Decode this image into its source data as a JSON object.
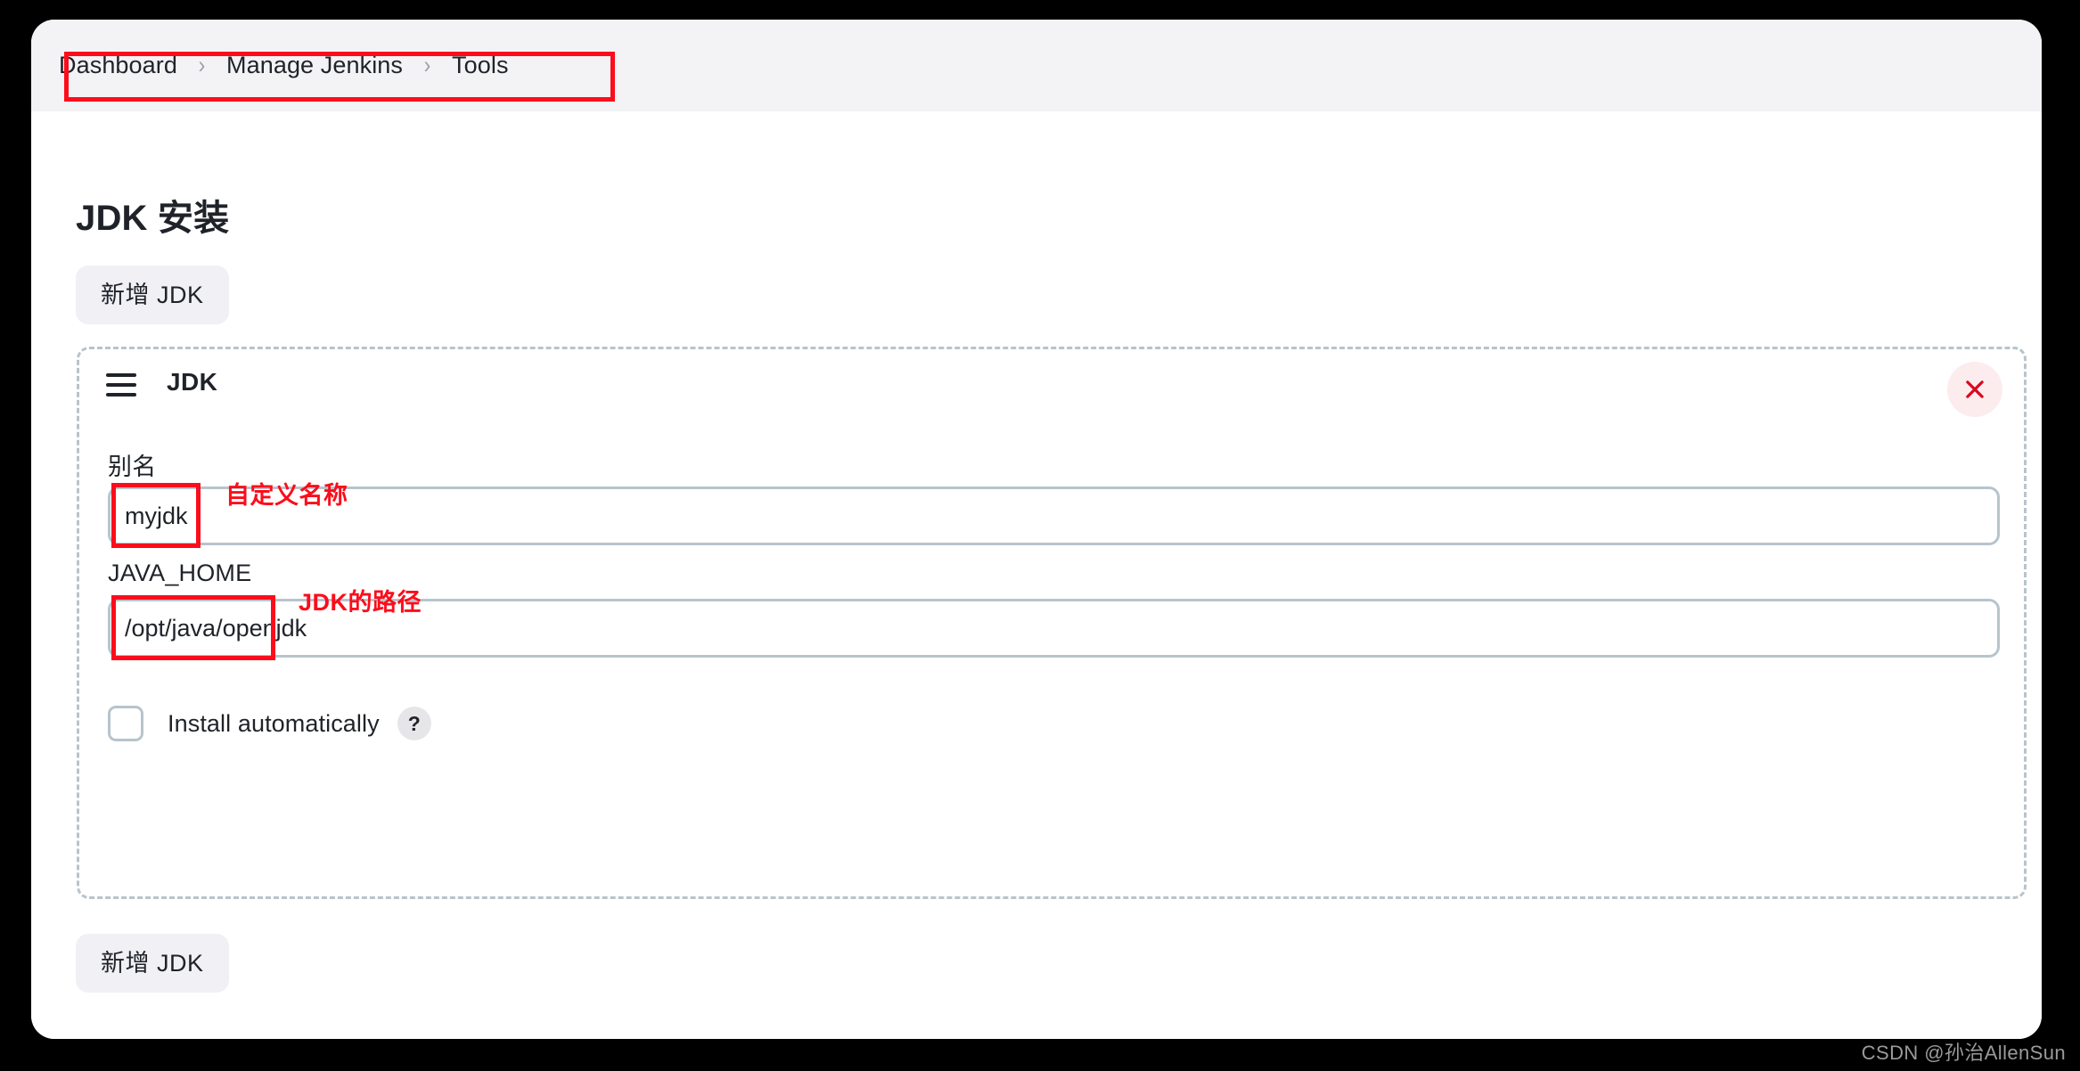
{
  "breadcrumb": {
    "items": [
      {
        "label": "Dashboard"
      },
      {
        "label": "Manage Jenkins"
      },
      {
        "label": "Tools"
      }
    ],
    "separator": "›"
  },
  "page": {
    "title": "JDK 安装",
    "add_button_top": "新增 JDK",
    "add_button_bottom": "新增 JDK"
  },
  "jdk_card": {
    "title": "JDK",
    "drag_handle_icon": "hamburger-icon",
    "delete_icon": "close-icon",
    "fields": {
      "alias": {
        "label": "别名",
        "value": "myjdk",
        "placeholder": "",
        "annotation": "自定义名称"
      },
      "java_home": {
        "label": "JAVA_HOME",
        "value": "/opt/java/openjdk",
        "placeholder": "",
        "annotation": "JDK的路径"
      }
    },
    "install_automatically": {
      "label": "Install automatically",
      "checked": false,
      "help_icon": "?"
    }
  },
  "watermark": "CSDN @孙治AllenSun",
  "colors": {
    "annotation_red": "#fc0d1b",
    "border_gray": "#b8c4cc",
    "button_bg": "#f0f0f5",
    "breadcrumb_bg": "#f3f3f6",
    "delete_bg": "#fdecee",
    "text": "#1f2329"
  }
}
